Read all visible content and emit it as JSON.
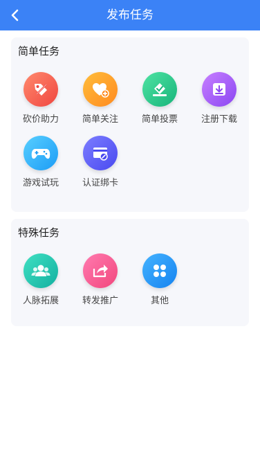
{
  "header": {
    "title": "发布任务",
    "bg": "#3b82f6"
  },
  "sections": [
    {
      "title": "简单任务",
      "items": [
        {
          "label": "砍价助力",
          "icon": "tag-cut-icon",
          "gradient": [
            "#ff8a6e",
            "#f0453f"
          ]
        },
        {
          "label": "简单关注",
          "icon": "heart-plus-icon",
          "gradient": [
            "#ffbd3b",
            "#ff8a1f"
          ]
        },
        {
          "label": "简单投票",
          "icon": "ballot-check-icon",
          "gradient": [
            "#4fe3a3",
            "#17b47a"
          ]
        },
        {
          "label": "注册下载",
          "icon": "download-icon",
          "gradient": [
            "#c780ff",
            "#8b46f2"
          ]
        },
        {
          "label": "游戏试玩",
          "icon": "gamepad-icon",
          "gradient": [
            "#58cfff",
            "#1c9cf6"
          ]
        },
        {
          "label": "认证绑卡",
          "icon": "card-link-icon",
          "gradient": [
            "#7c7dff",
            "#4a4af0"
          ]
        }
      ]
    },
    {
      "title": "特殊任务",
      "items": [
        {
          "label": "人脉拓展",
          "icon": "contacts-icon",
          "gradient": [
            "#41e0c2",
            "#12b0a0"
          ]
        },
        {
          "label": "转发推广",
          "icon": "share-icon",
          "gradient": [
            "#ff7bb0",
            "#f2467c"
          ]
        },
        {
          "label": "其他",
          "icon": "clover-icon",
          "gradient": [
            "#45b3ff",
            "#1583f0"
          ]
        }
      ]
    }
  ]
}
